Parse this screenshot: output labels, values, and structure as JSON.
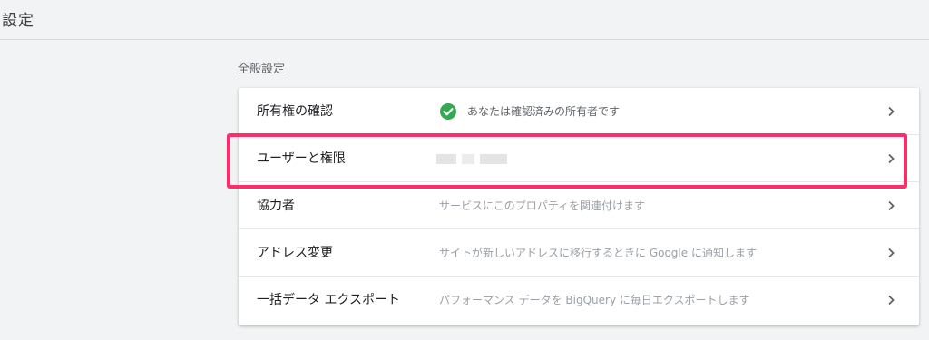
{
  "header": {
    "title": "設定"
  },
  "section": {
    "title": "全般設定"
  },
  "rows": [
    {
      "label": "所有権の確認",
      "desc": "あなたは確認済みの所有者です",
      "status_icon": "check-circle-icon",
      "status_color": "#34a853"
    },
    {
      "label": "ユーザーと権限",
      "desc": ""
    },
    {
      "label": "協力者",
      "desc": "サービスにこのプロパティを関連付けます"
    },
    {
      "label": "アドレス変更",
      "desc": "サイトが新しいアドレスに移行するときに Google に通知します"
    },
    {
      "label": "一括データ エクスポート",
      "desc": "パフォーマンス データを BigQuery に毎日エクスポートします"
    }
  ],
  "highlight_color": "#ff2e6a",
  "chevron_icon": "chevron-right-icon"
}
